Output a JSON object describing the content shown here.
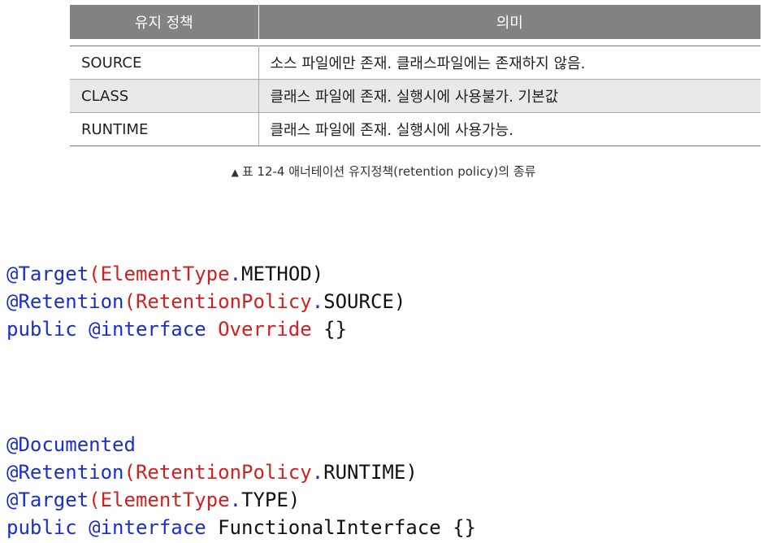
{
  "table": {
    "headers": [
      "유지 정책",
      "의미"
    ],
    "rows": [
      {
        "policy": "SOURCE",
        "meaning": "소스 파일에만 존재. 클래스파일에는 존재하지 않음."
      },
      {
        "policy": "CLASS",
        "meaning": "클래스 파일에 존재. 실행시에 사용불가. 기본값"
      },
      {
        "policy": "RUNTIME",
        "meaning": "클래스 파일에 존재. 실행시에 사용가능."
      }
    ]
  },
  "caption": {
    "marker": "▲",
    "text": "표 12-4  애너테이션 유지정책(retention policy)의 종류"
  },
  "code1": {
    "line1": {
      "annotation": "@Target",
      "paren_open": "(",
      "type": "ElementType",
      "dot": ".",
      "value": "METHOD",
      "paren_close": ")"
    },
    "line2": {
      "annotation": "@Retention",
      "paren_open": "(",
      "type": "RetentionPolicy",
      "dot": ".",
      "value": "SOURCE",
      "paren_close": ")"
    },
    "line3": {
      "kw": "public",
      "iface": "@interface",
      "name": "Override",
      "body": "{}"
    }
  },
  "code2": {
    "line1": {
      "annotation": "@Documented"
    },
    "line2": {
      "annotation": "@Retention",
      "paren_open": "(",
      "type": "RetentionPolicy",
      "dot": ".",
      "value": "RUNTIME",
      "paren_close": ")"
    },
    "line3": {
      "annotation": "@Target",
      "paren_open": "(",
      "type": "ElementType",
      "dot": ".",
      "value": "TYPE",
      "paren_close": ")"
    },
    "line4": {
      "kw": "public",
      "iface": "@interface",
      "name": "FunctionalInterface",
      "body": "{}"
    }
  },
  "colors": {
    "header_bg": "#838383",
    "row_shade": "#e9e9e9",
    "code_blue": "#1a2fc8",
    "code_red": "#d12020"
  }
}
